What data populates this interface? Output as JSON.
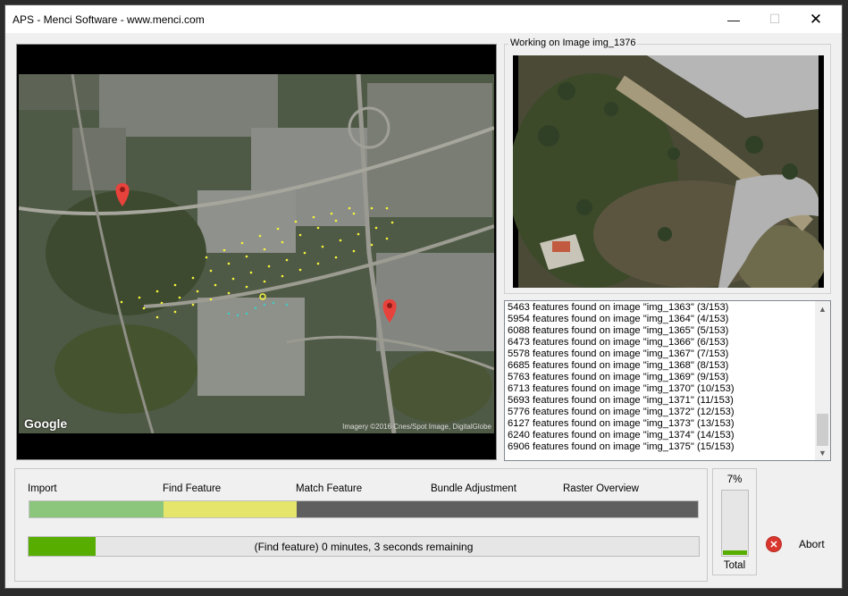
{
  "window": {
    "title": "APS - Menci Software - www.menci.com",
    "min_icon": "minimize-icon",
    "max_icon": "maximize-icon",
    "close_icon": "close-icon"
  },
  "map": {
    "logo": "Google",
    "attribution": "Imagery ©2016 Cnes/Spot Image, DigitalGlobe"
  },
  "preview": {
    "label": "Working on Image img_1376"
  },
  "log": {
    "lines": [
      "5463 features found on image \"img_1363\" (3/153)",
      "5954 features found on image \"img_1364\" (4/153)",
      "6088 features found on image \"img_1365\" (5/153)",
      "6473 features found on image \"img_1366\" (6/153)",
      "5578 features found on image \"img_1367\" (7/153)",
      "6685 features found on image \"img_1368\" (8/153)",
      "5763 features found on image \"img_1369\" (9/153)",
      "6713 features found on image \"img_1370\" (10/153)",
      "5693 features found on image \"img_1371\" (11/153)",
      "5776 features found on image \"img_1372\" (12/153)",
      "6127 features found on image \"img_1373\" (13/153)",
      "6240 features found on image \"img_1374\" (14/153)",
      "6906 features found on image \"img_1375\" (15/153)"
    ]
  },
  "stages": {
    "labels": [
      "Import",
      "Find Feature",
      "Match Feature",
      "Bundle Adjustment",
      "Raster Overview"
    ],
    "completed_color": "#8cc67d",
    "active_color": "#e4e56a",
    "pending_color": "#5f5f5f",
    "completed_fraction": 0.2,
    "active_fraction": 0.2
  },
  "task": {
    "text": "(Find feature) 0 minutes, 3 seconds remaining",
    "progress": 0.1,
    "color": "#57ad00"
  },
  "total": {
    "percent_text": "7%",
    "progress": 0.07,
    "label": "Total"
  },
  "abort": {
    "label": "Abort",
    "icon": "abort-icon",
    "color": "#d9372e"
  }
}
